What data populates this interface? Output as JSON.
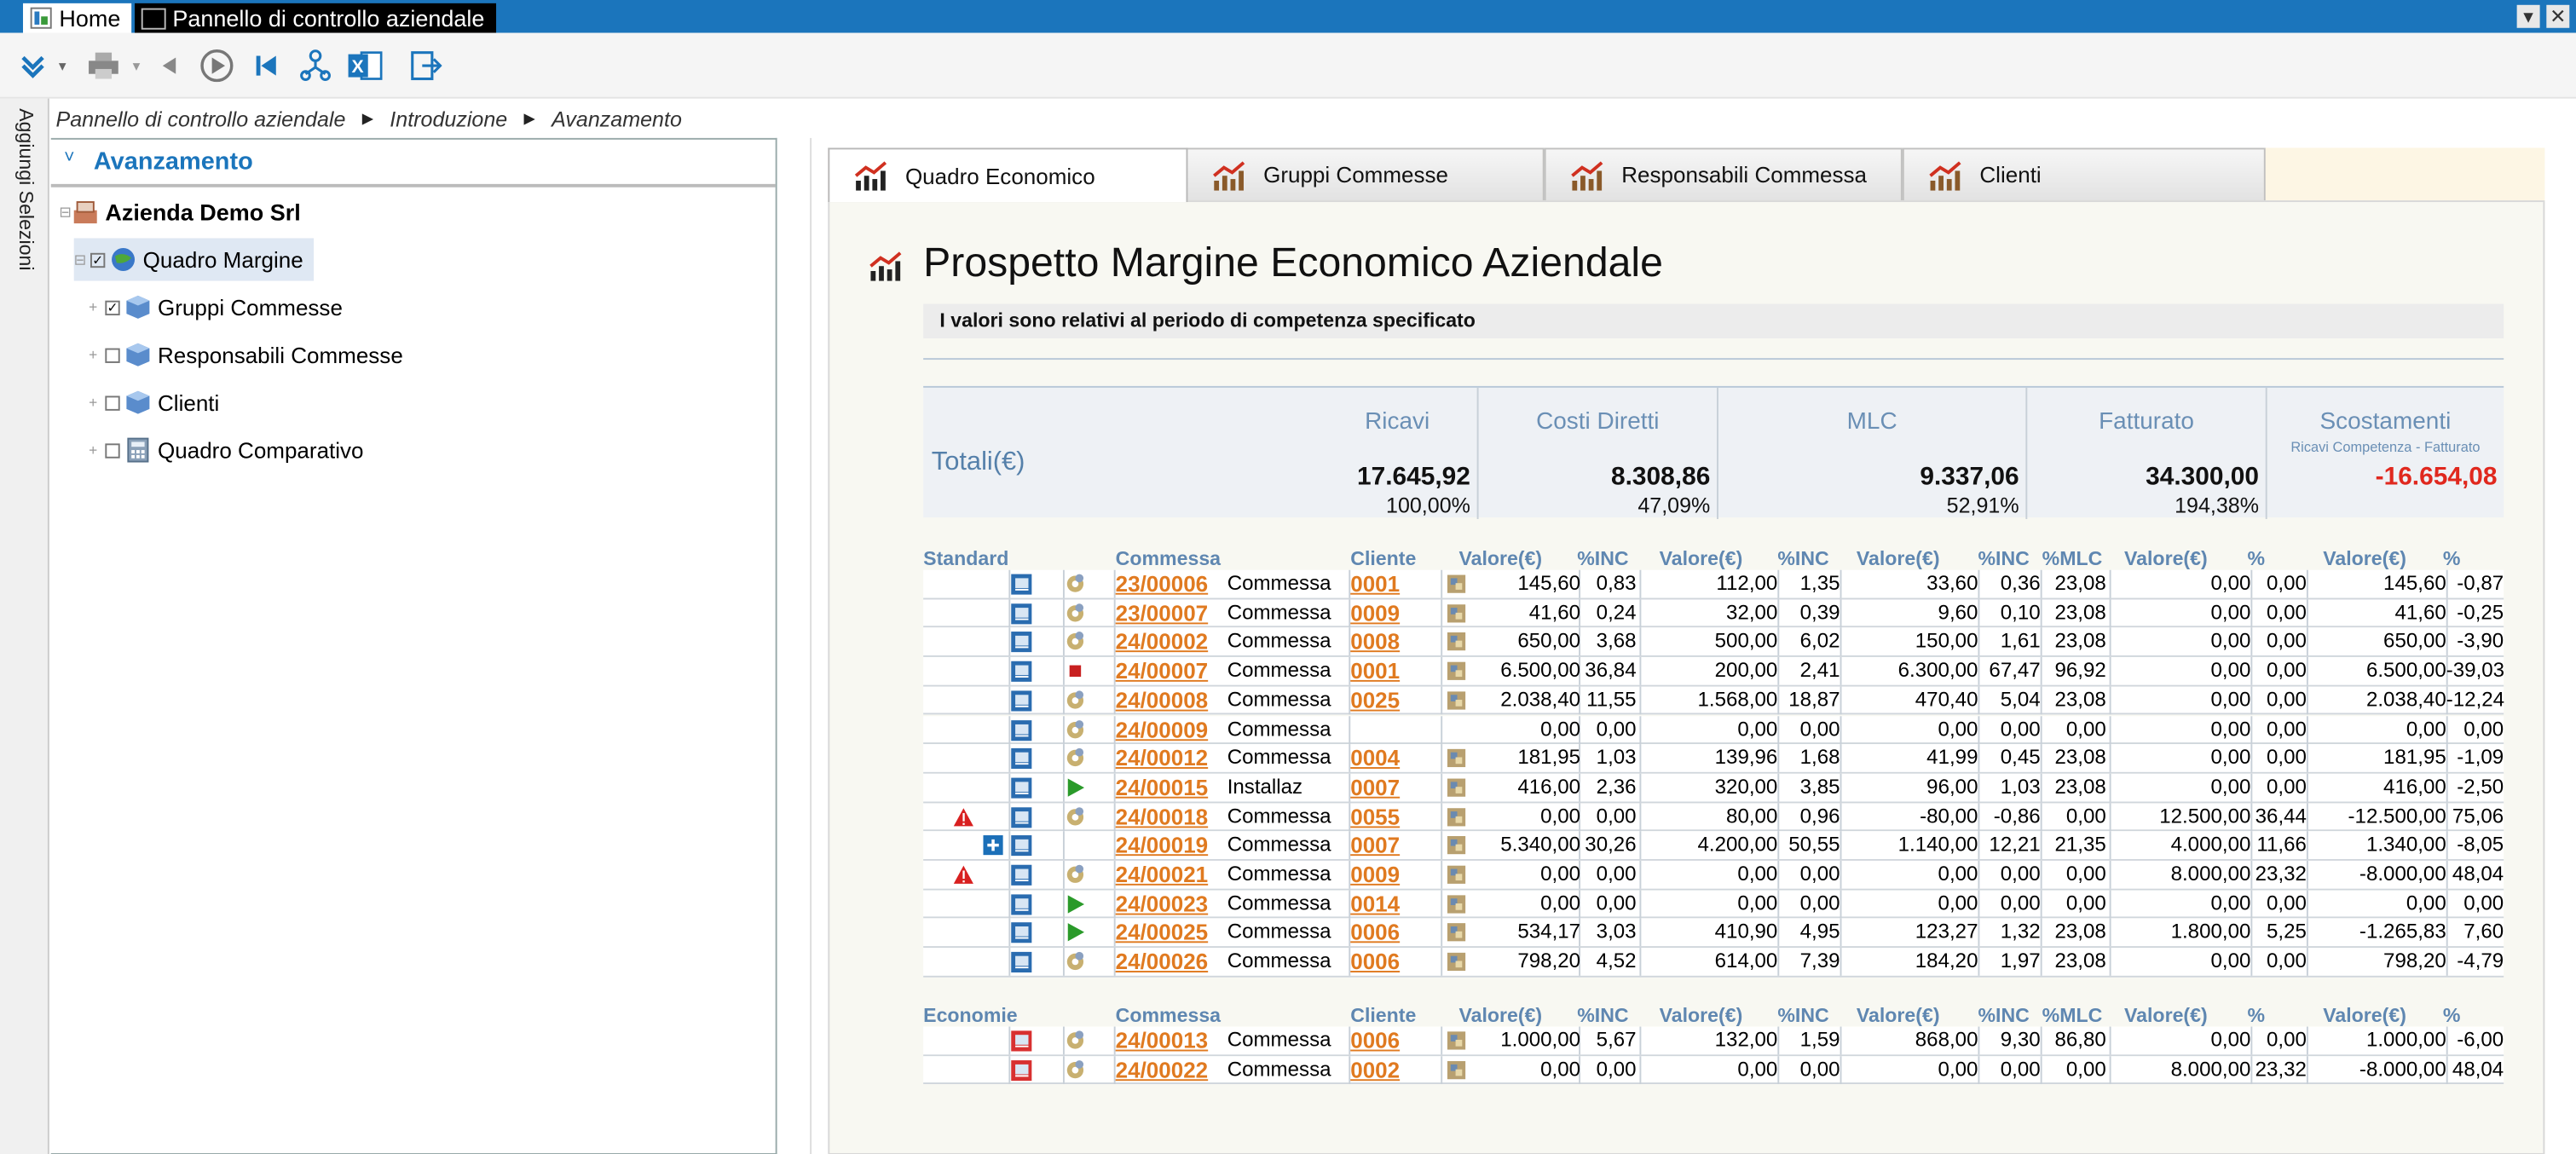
{
  "titlebar": {
    "home_tab": "Home",
    "active_tab": "Pannello di controllo aziendale",
    "btn_min": "▾",
    "btn_close": "✕"
  },
  "sidebar_strip": {
    "label": "Aggiungi Selezioni"
  },
  "breadcrumb": [
    "Pannello di controllo aziendale",
    "Introduzione",
    "Avanzamento"
  ],
  "tree": {
    "header": "Avanzamento",
    "root": "Azienda Demo Srl",
    "nodes": [
      {
        "label": "Quadro Margine"
      },
      {
        "label": "Gruppi Commesse"
      },
      {
        "label": "Responsabili Commesse"
      },
      {
        "label": "Clienti"
      },
      {
        "label": "Quadro Comparativo"
      }
    ]
  },
  "tabs": [
    "Quadro Economico",
    "Gruppi Commesse",
    "Responsabili Commessa",
    "Clienti"
  ],
  "report": {
    "title": "Prospetto Margine Economico Aziendale",
    "subtitle": "I valori sono relativi al periodo di competenza specificato",
    "totals_label": "Totali(€)",
    "totals": [
      {
        "head": "Ricavi",
        "value": "17.645,92",
        "pct": "100,00%"
      },
      {
        "head": "Costi Diretti",
        "value": "8.308,86",
        "pct": "47,09%"
      },
      {
        "head": "MLC",
        "value": "9.337,06",
        "pct": "52,91%"
      },
      {
        "head": "Fatturato",
        "value": "34.300,00",
        "pct": "194,38%"
      },
      {
        "head": "Scostamenti",
        "subhead": "Ricavi Competenza - Fatturato",
        "value": "-16.654,08",
        "pct": ""
      }
    ],
    "headers_standard": [
      "Standard",
      "Commessa",
      "Cliente",
      "Valore(€)",
      "%INC",
      "Valore(€)",
      "%INC",
      "Valore(€)",
      "%INC",
      "%MLC",
      "Valore(€)",
      "%",
      "Valore(€)",
      "%"
    ],
    "headers_economie": [
      "Economie",
      "Commessa",
      "Cliente",
      "Valore(€)",
      "%INC",
      "Valore(€)",
      "%INC",
      "Valore(€)",
      "%INC",
      "%MLC",
      "Valore(€)",
      "%",
      "Valore(€)",
      "%"
    ],
    "standard_rows": [
      {
        "warn": false,
        "plus": false,
        "status": "gear",
        "code": "23/00006",
        "desc": "Commessa",
        "client": "0001",
        "v1": "145,60",
        "p1": "0,83",
        "v2": "112,00",
        "p2": "1,35",
        "v3": "33,60",
        "p3": "0,36",
        "mlc": "23,08",
        "v4": "0,00",
        "p4": "0,00",
        "v5": "145,60",
        "p5": "-0,87"
      },
      {
        "warn": false,
        "plus": false,
        "status": "gear",
        "code": "23/00007",
        "desc": "Commessa",
        "client": "0009",
        "v1": "41,60",
        "p1": "0,24",
        "v2": "32,00",
        "p2": "0,39",
        "v3": "9,60",
        "p3": "0,10",
        "mlc": "23,08",
        "v4": "0,00",
        "p4": "0,00",
        "v5": "41,60",
        "p5": "-0,25"
      },
      {
        "warn": false,
        "plus": false,
        "status": "gear",
        "code": "24/00002",
        "desc": "Commessa",
        "client": "0008",
        "v1": "650,00",
        "p1": "3,68",
        "v2": "500,00",
        "p2": "6,02",
        "v3": "150,00",
        "p3": "1,61",
        "mlc": "23,08",
        "v4": "0,00",
        "p4": "0,00",
        "v5": "650,00",
        "p5": "-3,90"
      },
      {
        "warn": false,
        "plus": false,
        "status": "stop",
        "code": "24/00007",
        "desc": "Commessa",
        "client": "0001",
        "v1": "6.500,00",
        "p1": "36,84",
        "v2": "200,00",
        "p2": "2,41",
        "v3": "6.300,00",
        "p3": "67,47",
        "mlc": "96,92",
        "v4": "0,00",
        "p4": "0,00",
        "v5": "6.500,00",
        "p5": "-39,03"
      },
      {
        "warn": false,
        "plus": false,
        "status": "gear",
        "code": "24/00008",
        "desc": "Commessa",
        "client": "0025",
        "v1": "2.038,40",
        "p1": "11,55",
        "v2": "1.568,00",
        "p2": "18,87",
        "v3": "470,40",
        "p3": "5,04",
        "mlc": "23,08",
        "v4": "0,00",
        "p4": "0,00",
        "v5": "2.038,40",
        "p5": "-12,24"
      },
      {
        "warn": false,
        "plus": false,
        "status": "gear",
        "code": "24/00009",
        "desc": "Commessa",
        "client": "",
        "v1": "0,00",
        "p1": "0,00",
        "v2": "0,00",
        "p2": "0,00",
        "v3": "0,00",
        "p3": "0,00",
        "mlc": "0,00",
        "v4": "0,00",
        "p4": "0,00",
        "v5": "0,00",
        "p5": "0,00"
      },
      {
        "warn": false,
        "plus": false,
        "status": "gear",
        "code": "24/00012",
        "desc": "Commessa",
        "client": "0004",
        "v1": "181,95",
        "p1": "1,03",
        "v2": "139,96",
        "p2": "1,68",
        "v3": "41,99",
        "p3": "0,45",
        "mlc": "23,08",
        "v4": "0,00",
        "p4": "0,00",
        "v5": "181,95",
        "p5": "-1,09"
      },
      {
        "warn": false,
        "plus": false,
        "status": "play",
        "code": "24/00015",
        "desc": "Installaz",
        "client": "0007",
        "v1": "416,00",
        "p1": "2,36",
        "v2": "320,00",
        "p2": "3,85",
        "v3": "96,00",
        "p3": "1,03",
        "mlc": "23,08",
        "v4": "0,00",
        "p4": "0,00",
        "v5": "416,00",
        "p5": "-2,50"
      },
      {
        "warn": true,
        "plus": false,
        "status": "gear",
        "code": "24/00018",
        "desc": "Commessa",
        "client": "0055",
        "v1": "0,00",
        "p1": "0,00",
        "v2": "80,00",
        "p2": "0,96",
        "v3": "-80,00",
        "p3": "-0,86",
        "mlc": "0,00",
        "v4": "12.500,00",
        "p4": "36,44",
        "v5": "-12.500,00",
        "p5": "75,06"
      },
      {
        "warn": false,
        "plus": true,
        "status": "none",
        "code": "24/00019",
        "desc": "Commessa",
        "client": "0007",
        "v1": "5.340,00",
        "p1": "30,26",
        "v2": "4.200,00",
        "p2": "50,55",
        "v3": "1.140,00",
        "p3": "12,21",
        "mlc": "21,35",
        "v4": "4.000,00",
        "p4": "11,66",
        "v5": "1.340,00",
        "p5": "-8,05"
      },
      {
        "warn": true,
        "plus": false,
        "status": "gear",
        "code": "24/00021",
        "desc": "Commessa",
        "client": "0009",
        "v1": "0,00",
        "p1": "0,00",
        "v2": "0,00",
        "p2": "0,00",
        "v3": "0,00",
        "p3": "0,00",
        "mlc": "0,00",
        "v4": "8.000,00",
        "p4": "23,32",
        "v5": "-8.000,00",
        "p5": "48,04"
      },
      {
        "warn": false,
        "plus": false,
        "status": "play",
        "code": "24/00023",
        "desc": "Commessa",
        "client": "0014",
        "v1": "0,00",
        "p1": "0,00",
        "v2": "0,00",
        "p2": "0,00",
        "v3": "0,00",
        "p3": "0,00",
        "mlc": "0,00",
        "v4": "0,00",
        "p4": "0,00",
        "v5": "0,00",
        "p5": "0,00"
      },
      {
        "warn": false,
        "plus": false,
        "status": "play",
        "code": "24/00025",
        "desc": "Commessa",
        "client": "0006",
        "v1": "534,17",
        "p1": "3,03",
        "v2": "410,90",
        "p2": "4,95",
        "v3": "123,27",
        "p3": "1,32",
        "mlc": "23,08",
        "v4": "1.800,00",
        "p4": "5,25",
        "v5": "-1.265,83",
        "p5": "7,60"
      },
      {
        "warn": false,
        "plus": false,
        "status": "gear",
        "code": "24/00026",
        "desc": "Commessa",
        "client": "0006",
        "v1": "798,20",
        "p1": "4,52",
        "v2": "614,00",
        "p2": "7,39",
        "v3": "184,20",
        "p3": "1,97",
        "mlc": "23,08",
        "v4": "0,00",
        "p4": "0,00",
        "v5": "798,20",
        "p5": "-4,79"
      }
    ],
    "economie_rows": [
      {
        "warn": false,
        "plus": false,
        "status": "gear",
        "code": "24/00013",
        "desc": "Commessa",
        "client": "0006",
        "v1": "1.000,00",
        "p1": "5,67",
        "v2": "132,00",
        "p2": "1,59",
        "v3": "868,00",
        "p3": "9,30",
        "mlc": "86,80",
        "v4": "0,00",
        "p4": "0,00",
        "v5": "1.000,00",
        "p5": "-6,00"
      },
      {
        "warn": false,
        "plus": false,
        "status": "gear",
        "code": "24/00022",
        "desc": "Commessa",
        "client": "0002",
        "v1": "0,00",
        "p1": "0,00",
        "v2": "0,00",
        "p2": "0,00",
        "v3": "0,00",
        "p3": "0,00",
        "mlc": "0,00",
        "v4": "8.000,00",
        "p4": "23,32",
        "v5": "-8.000,00",
        "p5": "48,04"
      }
    ]
  },
  "colors": {
    "accent": "#1b75bc",
    "header_blue": "#5f87b1",
    "link_orange": "#e07a20",
    "negative_red": "#e0281e"
  }
}
